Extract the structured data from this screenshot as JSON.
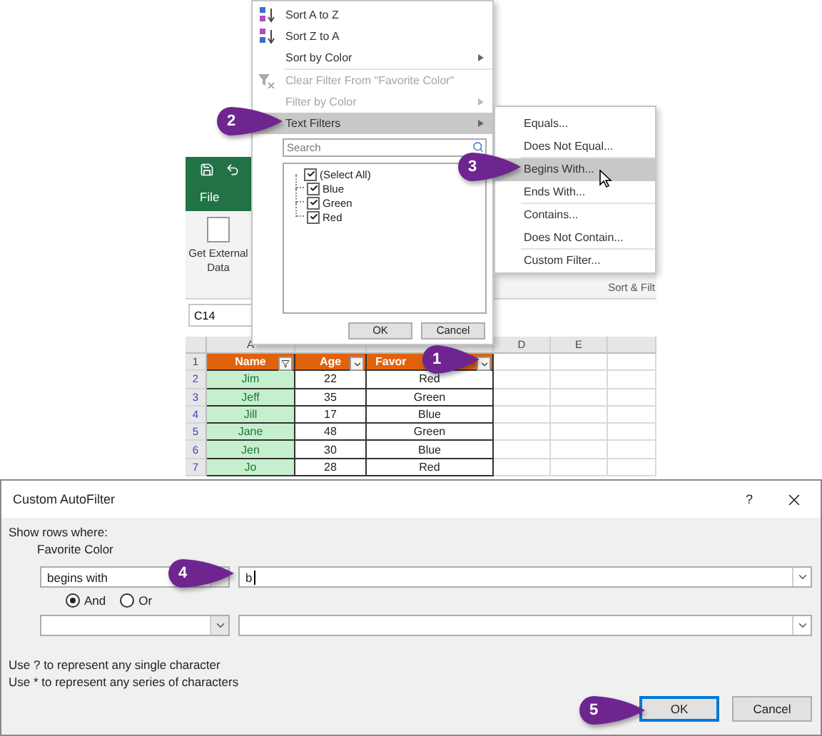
{
  "spreadsheet": {
    "ribbon_tab": "File",
    "ribbon_button": "Get External Data",
    "group_label": "Sort & Filt",
    "name_box": "C14",
    "column_headers": [
      "A",
      "D",
      "E"
    ],
    "header": {
      "number": "1",
      "cells": [
        {
          "text": "Name",
          "filtered": true
        },
        {
          "text": "Age",
          "filtered": false
        },
        {
          "text": "Favor",
          "filtered": false
        }
      ]
    },
    "rows": [
      {
        "number": "2",
        "name": "Jim",
        "age": "22",
        "favorite": "Red"
      },
      {
        "number": "3",
        "name": "Jeff",
        "age": "35",
        "favorite": "Green"
      },
      {
        "number": "4",
        "name": "Jill",
        "age": "17",
        "favorite": "Blue"
      },
      {
        "number": "5",
        "name": "Jane",
        "age": "48",
        "favorite": "Green"
      },
      {
        "number": "6",
        "name": "Jen",
        "age": "30",
        "favorite": "Blue"
      },
      {
        "number": "7",
        "name": "Jo",
        "age": "28",
        "favorite": "Red"
      }
    ]
  },
  "filter_menu": {
    "sections": [
      [
        {
          "label": "Sort A to Z",
          "kind": "sort-ascending",
          "disabled": false,
          "submenu": false,
          "selected": false
        },
        {
          "label": "Sort Z to A",
          "kind": "sort-descending",
          "disabled": false,
          "submenu": false,
          "selected": false
        },
        {
          "label": "Sort by Color",
          "kind": "plain",
          "disabled": false,
          "submenu": true,
          "selected": false
        }
      ],
      [
        {
          "label": "Clear Filter From \"Favorite Color\"",
          "kind": "clear-filter",
          "disabled": true,
          "submenu": false,
          "selected": false
        },
        {
          "label": "Filter by Color",
          "kind": "plain",
          "disabled": true,
          "submenu": true,
          "selected": false
        },
        {
          "label": "Text Filters",
          "kind": "plain",
          "disabled": false,
          "submenu": true,
          "selected": true
        }
      ]
    ],
    "search": {
      "placeholder": "Search"
    },
    "values": [
      {
        "label": "(Select All)",
        "checked": true
      },
      {
        "label": "Blue",
        "checked": true
      },
      {
        "label": "Green",
        "checked": true
      },
      {
        "label": "Red",
        "checked": true
      }
    ],
    "buttons": [
      "OK",
      "Cancel"
    ]
  },
  "text_filters_menu": {
    "sections": [
      [
        {
          "label": "Equals...",
          "selected": false
        },
        {
          "label": "Does Not Equal...",
          "selected": false
        }
      ],
      [
        {
          "label": "Begins With...",
          "selected": true
        },
        {
          "label": "Ends With...",
          "selected": false
        }
      ],
      [
        {
          "label": "Contains...",
          "selected": false
        },
        {
          "label": "Does Not Contain...",
          "selected": false
        }
      ],
      [
        {
          "label": "Custom Filter...",
          "selected": false
        }
      ]
    ]
  },
  "dialog": {
    "title": "Custom AutoFilter",
    "help": "?",
    "show_rows_label": "Show rows where:",
    "field_label": "Favorite Color",
    "conditions": [
      {
        "operator": "begins with",
        "value": "b"
      }
    ],
    "logic": [
      {
        "label": "And",
        "selected": true
      },
      {
        "label": "Or",
        "selected": false
      }
    ],
    "hints": [
      "Use ? to represent any single character",
      "Use * to represent any series of characters"
    ],
    "buttons": [
      {
        "label": "OK",
        "default": true
      },
      {
        "label": "Cancel",
        "default": false
      }
    ]
  },
  "callouts": [
    "1",
    "2",
    "3",
    "4",
    "5"
  ]
}
